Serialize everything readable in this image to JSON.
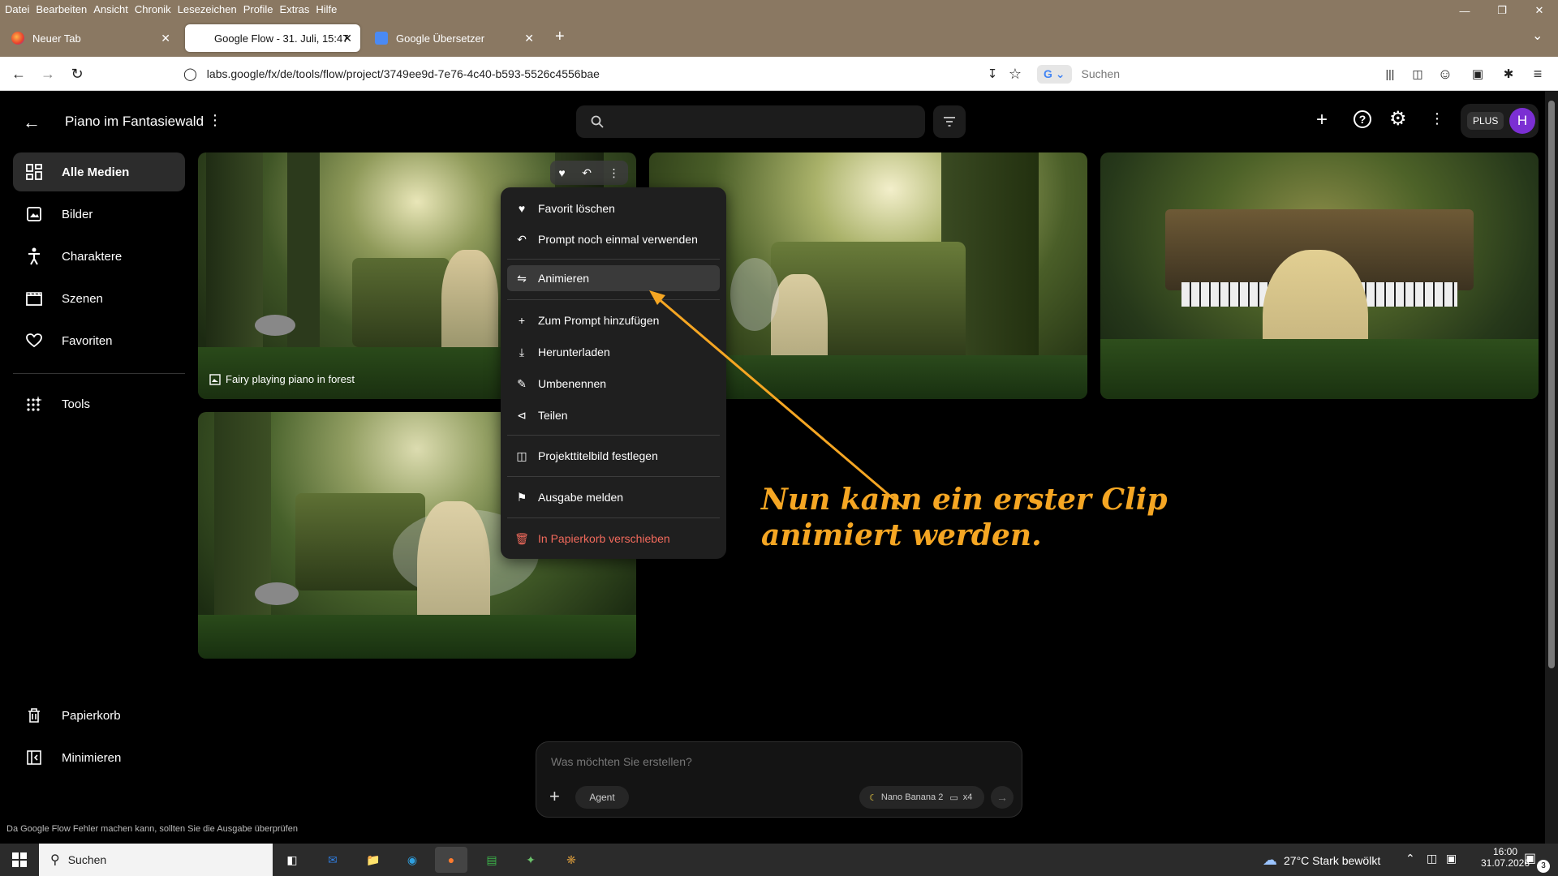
{
  "menubar": [
    "Datei",
    "Bearbeiten",
    "Ansicht",
    "Chronik",
    "Lesezeichen",
    "Profile",
    "Extras",
    "Hilfe"
  ],
  "tabs": [
    {
      "label": "Neuer Tab",
      "active": false
    },
    {
      "label": "Google Flow - 31. Juli, 15:47",
      "active": true
    },
    {
      "label": "Google Übersetzer",
      "active": false
    }
  ],
  "urlbar": {
    "url": "labs.google/fx/de/tools/flow/project/3749ee9d-7e76-4c40-b593-5526c4556bae"
  },
  "browser_search": {
    "placeholder": "Suchen"
  },
  "app": {
    "project_title": "Piano im Fantasiewald",
    "plus_label": "PLUS",
    "avatar_letter": "H"
  },
  "sidebar": {
    "items": [
      {
        "label": "Alle Medien",
        "icon": "grid-icon",
        "active": true
      },
      {
        "label": "Bilder",
        "icon": "image-icon",
        "active": false
      },
      {
        "label": "Charaktere",
        "icon": "person-icon",
        "active": false
      },
      {
        "label": "Szenen",
        "icon": "clapperboard-icon",
        "active": false
      },
      {
        "label": "Favoriten",
        "icon": "heart-icon",
        "active": false
      },
      {
        "label": "Tools",
        "icon": "sparkle-grid-icon",
        "active": false
      }
    ],
    "bottom": [
      {
        "label": "Papierkorb",
        "icon": "trash-icon"
      },
      {
        "label": "Minimieren",
        "icon": "collapse-icon"
      }
    ]
  },
  "media": {
    "caption": "Fairy playing piano in forest"
  },
  "context_menu": {
    "items": [
      {
        "label": "Favorit löschen",
        "icon": "heart-icon"
      },
      {
        "label": "Prompt noch einmal verwenden",
        "icon": "reuse-icon"
      },
      {
        "label": "Animieren",
        "icon": "animate-icon",
        "highlighted": true
      },
      {
        "label": "Zum Prompt hinzufügen",
        "icon": "plus-icon"
      },
      {
        "label": "Herunterladen",
        "icon": "download-icon"
      },
      {
        "label": "Umbenennen",
        "icon": "pencil-icon"
      },
      {
        "label": "Teilen",
        "icon": "share-icon"
      },
      {
        "label": "Projekttitelbild festlegen",
        "icon": "cover-icon"
      },
      {
        "label": "Ausgabe melden",
        "icon": "flag-icon"
      },
      {
        "label": "In Papierkorb verschieben",
        "icon": "trash-icon",
        "danger": true
      }
    ]
  },
  "annotation": {
    "line1": "Nun kann ein erster Clip",
    "line2": "animiert werden.",
    "color": "#f5a623"
  },
  "composer": {
    "placeholder": "Was möchten Sie erstellen?",
    "agent_label": "Agent",
    "model_label": "Nano Banana 2",
    "count_label": "x4"
  },
  "footer_note": "Da Google Flow Fehler machen kann, sollten Sie die Ausgabe überprüfen",
  "taskbar": {
    "search_label": "Suchen",
    "weather": "27°C  Stark bewölkt",
    "time": "16:00",
    "date": "31.07.2026",
    "notification_count": "3"
  }
}
